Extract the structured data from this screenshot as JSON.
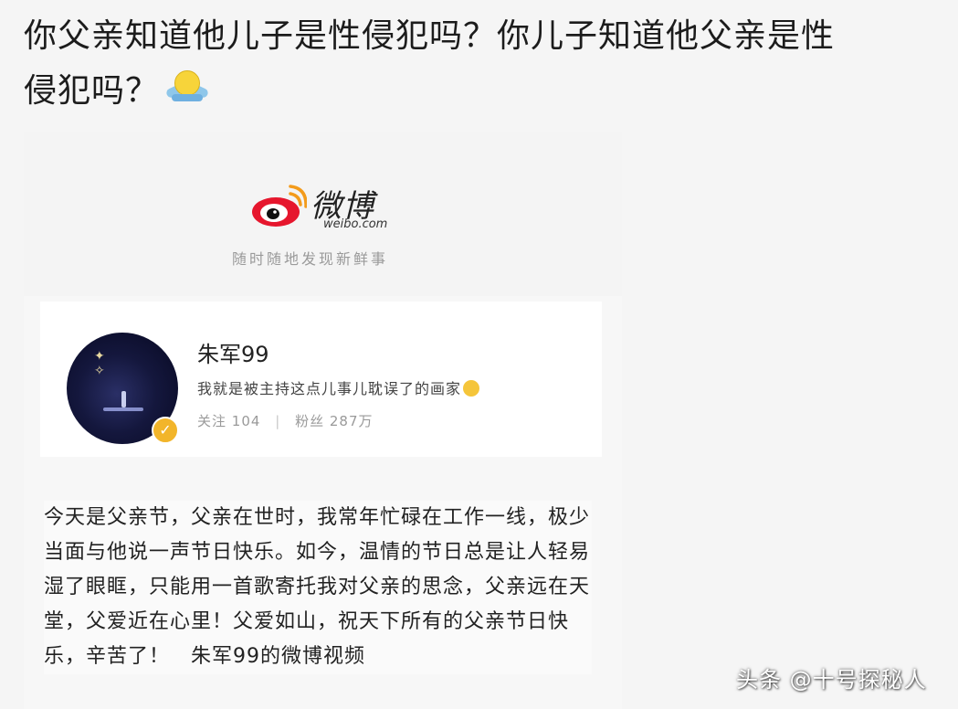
{
  "post": {
    "text_line1": "你父亲知道他儿子是性侵犯吗？你儿子知道他父亲是性",
    "text_line2": "侵犯吗？",
    "emoji_icon": "holding-face-emoji"
  },
  "weibo": {
    "logo_title": "微博",
    "logo_sub": "weibo.com",
    "slogan": "随时随地发现新鲜事",
    "logo_icon": "weibo-eye-icon",
    "brand_color": "#e6162d"
  },
  "profile": {
    "username": "朱军99",
    "bio": "我就是被主持这点儿事儿耽误了的画家",
    "following_label": "关注",
    "following_count": "104",
    "followers_label": "粉丝",
    "followers_count": "287万",
    "badge_icon": "verified-badge-icon"
  },
  "post_body": {
    "text": "今天是父亲节，父亲在世时，我常年忙碌在工作一线，极少当面与他说一声节日快乐。如今，温情的节日总是让人轻易湿了眼眶，只能用一首歌寄托我对父亲的思念，父亲远在天堂，父爱近在心里！父爱如山，祝天下所有的父亲节日快乐，辛苦了！　朱军99的微博视频"
  },
  "watermark": {
    "text": "头条 @十号探秘人"
  }
}
